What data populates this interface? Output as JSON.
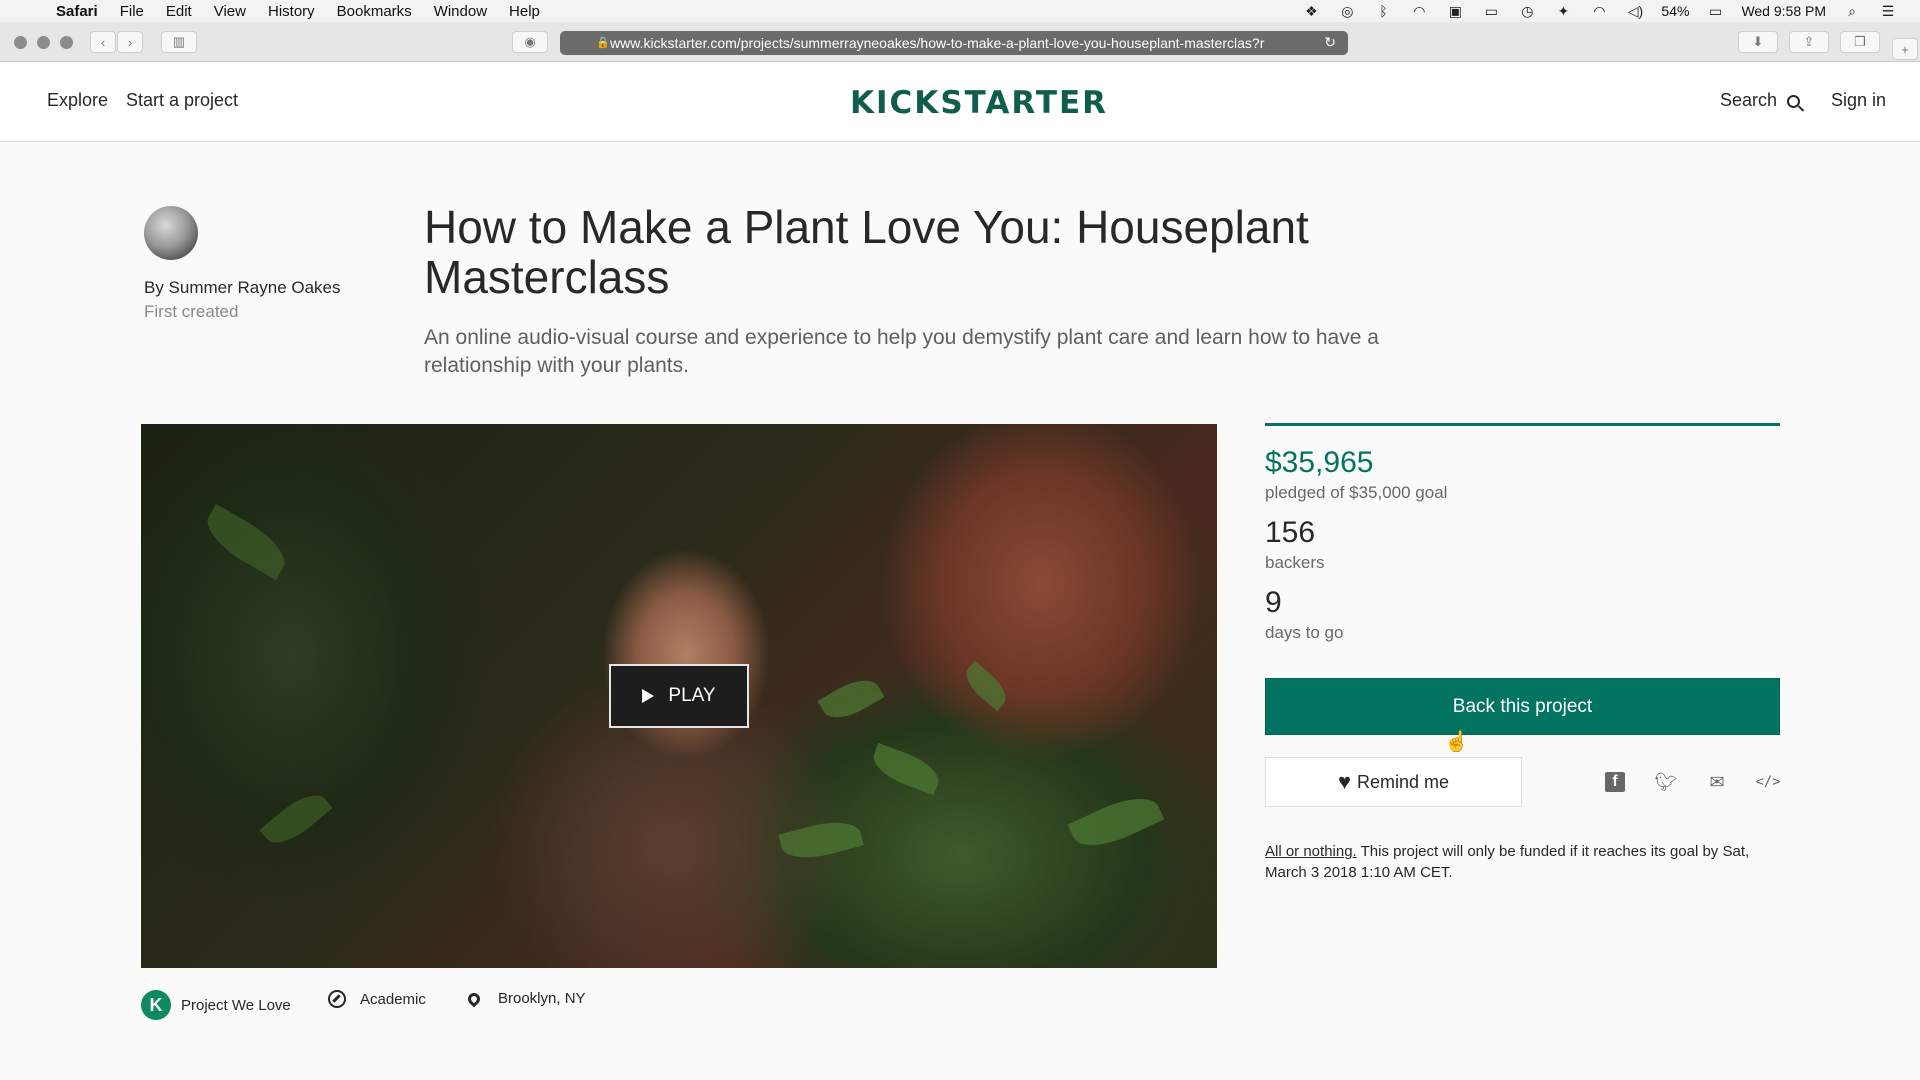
{
  "menubar": {
    "app": "Safari",
    "items": [
      "File",
      "Edit",
      "View",
      "History",
      "Bookmarks",
      "Window",
      "Help"
    ],
    "battery": "54%",
    "clock": "Wed 9:58 PM"
  },
  "browser": {
    "url": "www.kickstarter.com/projects/summerrayneoakes/how-to-make-a-plant-love-you-houseplant-masterclas?r"
  },
  "header": {
    "explore": "Explore",
    "start": "Start a project",
    "logo": "KICKSTARTER",
    "search": "Search",
    "signin": "Sign in"
  },
  "project": {
    "byline": "By Summer Rayne Oakes",
    "first_created": "First created",
    "title": "How to Make a Plant Love You: Houseplant Masterclass",
    "subtitle": "An online audio-visual course and experience to help you demystify plant care and learn how to have a relationship with your plants.",
    "play": "PLAY",
    "badge_letter": "K",
    "project_we_love": "Project We Love",
    "category": "Academic",
    "location": "Brooklyn, NY"
  },
  "stats": {
    "funded_fraction": 1.0,
    "pledged": "$35,965",
    "pledged_label": "pledged of $35,000 goal",
    "backers": "156",
    "backers_label": "backers",
    "days": "9",
    "days_label": "days to go",
    "back_button": "Back this project",
    "remind": "Remind me",
    "embed": "</>",
    "all_or_nothing": "All or nothing.",
    "funding_note": " This project will only be funded if it reaches its goal by Sat, March 3 2018 1:10 AM CET."
  },
  "colors": {
    "brand": "#037362",
    "logo": "#0f5e4d"
  }
}
